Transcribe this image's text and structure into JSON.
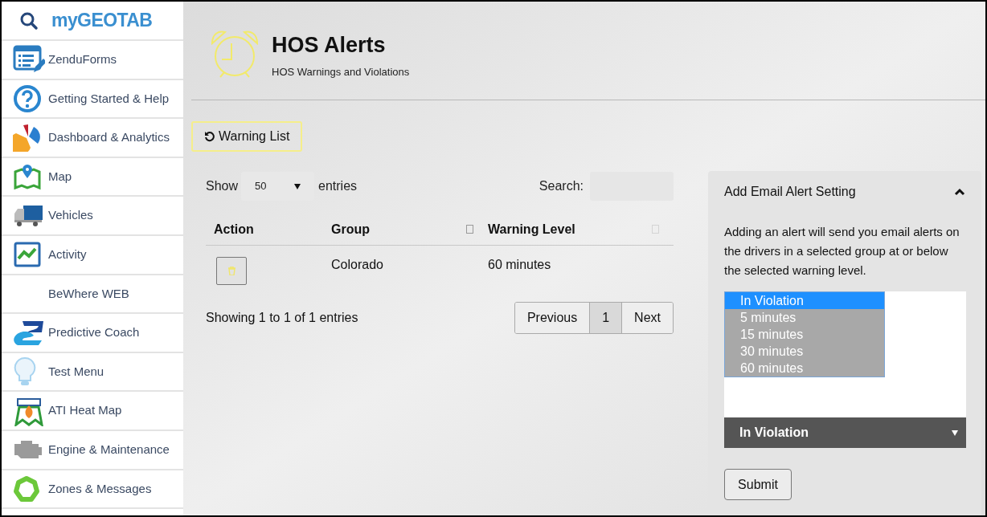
{
  "sidebar": {
    "logo": "myGEOTAB",
    "items": [
      {
        "label": "ZenduForms"
      },
      {
        "label": "Getting Started & Help"
      },
      {
        "label": "Dashboard & Analytics"
      },
      {
        "label": "Map"
      },
      {
        "label": "Vehicles"
      },
      {
        "label": "Activity"
      },
      {
        "label": "BeWhere WEB"
      },
      {
        "label": "Predictive Coach"
      },
      {
        "label": "Test Menu"
      },
      {
        "label": "ATI Heat Map"
      },
      {
        "label": "Engine & Maintenance"
      },
      {
        "label": "Zones & Messages"
      }
    ]
  },
  "header": {
    "title": "HOS Alerts",
    "subtitle": "HOS Warnings and Violations"
  },
  "warning_list_button": "Warning List",
  "table": {
    "show_label": "Show",
    "page_size": "50",
    "entries_label": "entries",
    "search_label": "Search:",
    "columns": [
      {
        "label": "Action",
        "sortable": false
      },
      {
        "label": "Group",
        "sortable": true
      },
      {
        "label": "Warning Level",
        "sortable": true
      }
    ],
    "rows": [
      {
        "group": "Colorado",
        "warning_level": "60 minutes"
      }
    ],
    "info": "Showing 1 to 1 of 1 entries",
    "pagination": [
      {
        "label": "Previous",
        "selected": false
      },
      {
        "label": "1",
        "selected": true
      },
      {
        "label": "Next",
        "selected": false
      }
    ]
  },
  "panel": {
    "title": "Add Email Alert Setting",
    "expanded": true,
    "description": "Adding an alert will send you email alerts on the drivers in a selected group at or below the selected warning level.",
    "options": [
      {
        "label": "In Violation",
        "selected": true
      },
      {
        "label": "5 minutes",
        "selected": false
      },
      {
        "label": "15 minutes",
        "selected": false
      },
      {
        "label": "30 minutes",
        "selected": false
      },
      {
        "label": "60 minutes",
        "selected": false
      }
    ],
    "select_value": "In Violation",
    "submit": "Submit"
  }
}
